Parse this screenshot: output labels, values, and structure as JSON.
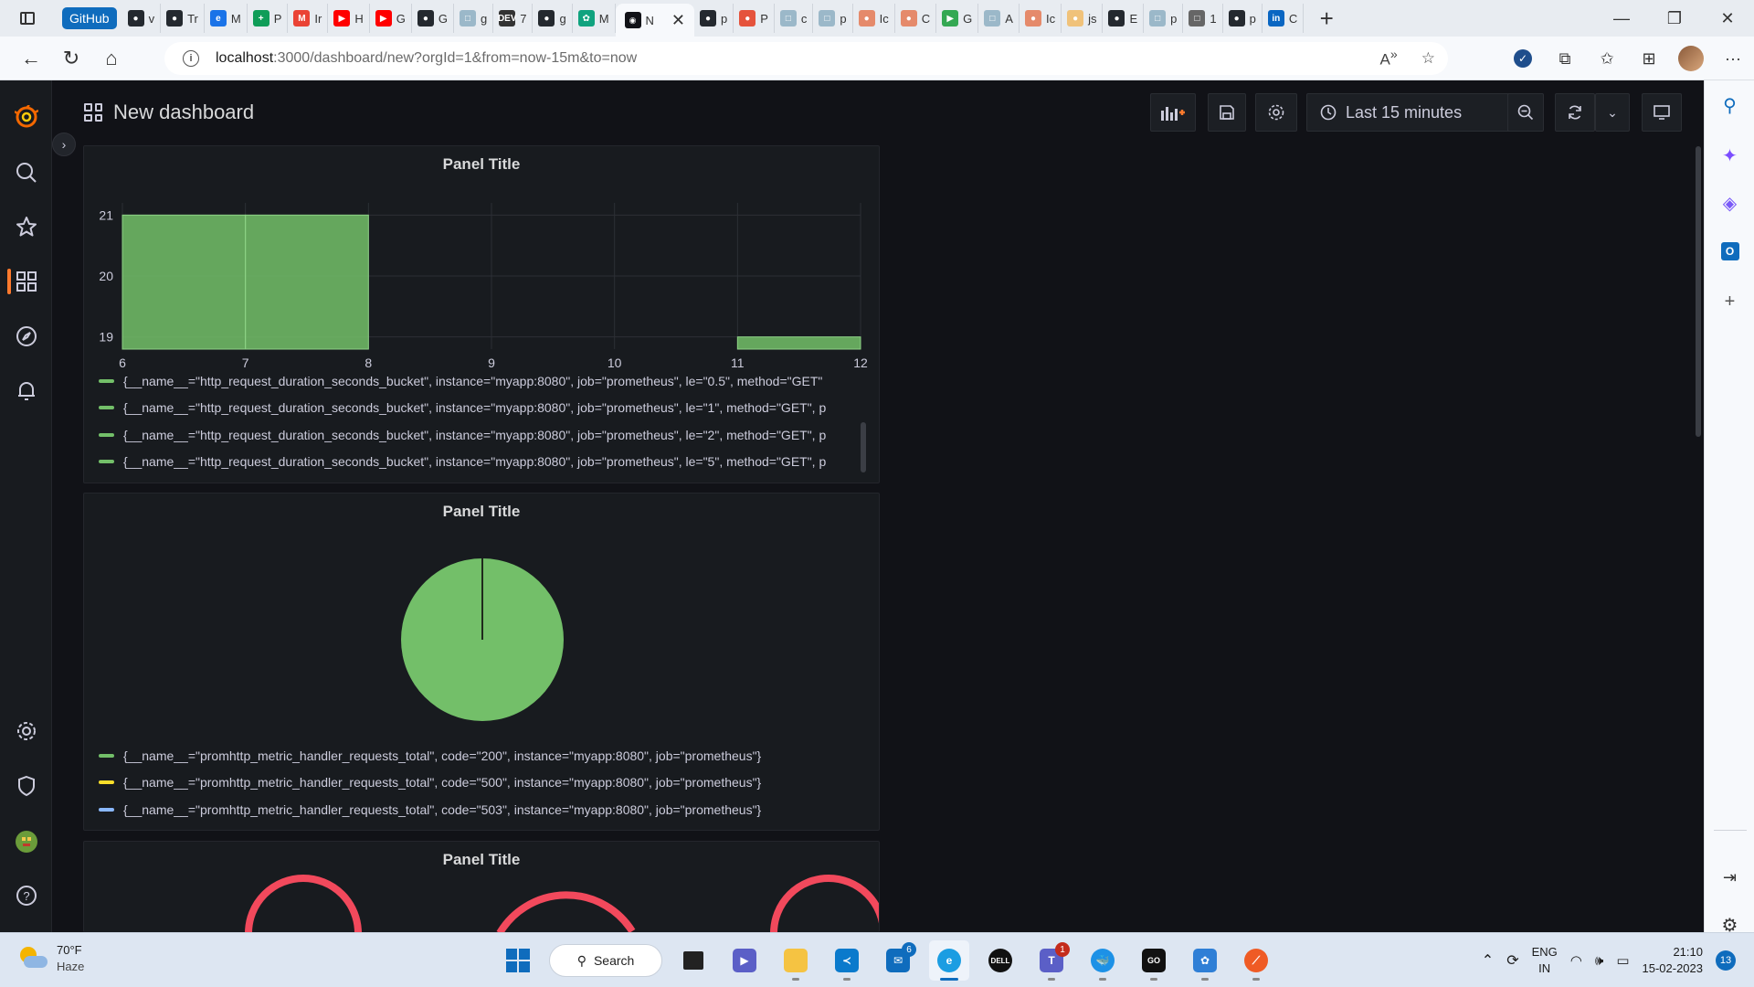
{
  "browser": {
    "tab_group_label": "GitHub",
    "tabs": [
      {
        "label": "v",
        "color": "#24292f",
        "glyph": "●"
      },
      {
        "label": "Tr",
        "color": "#24292f",
        "glyph": "●"
      },
      {
        "label": "M",
        "color": "#1a73e8",
        "glyph": "e"
      },
      {
        "label": "P",
        "color": "#0f9d58",
        "glyph": "+"
      },
      {
        "label": "Ir",
        "color": "#ea4335",
        "glyph": "M"
      },
      {
        "label": "H",
        "color": "#ff0000",
        "glyph": "▶"
      },
      {
        "label": "G",
        "color": "#ff0000",
        "glyph": "▶"
      },
      {
        "label": "G",
        "color": "#24292f",
        "glyph": "●"
      },
      {
        "label": "g",
        "color": "#9bb8c9",
        "glyph": "□"
      },
      {
        "label": "7",
        "color": "#333333",
        "glyph": "DEV"
      },
      {
        "label": "g",
        "color": "#24292f",
        "glyph": "●"
      },
      {
        "label": "M",
        "color": "#10a37f",
        "glyph": "✿"
      }
    ],
    "active_tab_label": "N",
    "tabs_after": [
      {
        "label": "p",
        "color": "#24292f",
        "glyph": "●"
      },
      {
        "label": "P",
        "color": "#e5533c",
        "glyph": "●"
      },
      {
        "label": "c",
        "color": "#9bb8c9",
        "glyph": "□"
      },
      {
        "label": "p",
        "color": "#9bb8c9",
        "glyph": "□"
      },
      {
        "label": "Ic",
        "color": "#e58a6b",
        "glyph": "●"
      },
      {
        "label": "C",
        "color": "#e58a6b",
        "glyph": "●"
      },
      {
        "label": "G",
        "color": "#34a853",
        "glyph": "▶"
      },
      {
        "label": "A",
        "color": "#9bb8c9",
        "glyph": "□"
      },
      {
        "label": "Ic",
        "color": "#e58a6b",
        "glyph": "●"
      },
      {
        "label": "js",
        "color": "#f0c27a",
        "glyph": "●"
      },
      {
        "label": "E",
        "color": "#24292f",
        "glyph": "●"
      },
      {
        "label": "p",
        "color": "#9bb8c9",
        "glyph": "□"
      },
      {
        "label": "1",
        "color": "#666666",
        "glyph": "□"
      },
      {
        "label": "p",
        "color": "#24292f",
        "glyph": "●"
      },
      {
        "label": "C",
        "color": "#0a66c2",
        "glyph": "in"
      }
    ],
    "url_host": "localhost",
    "url_rest": ":3000/dashboard/new?orgId=1&from=now-15m&to=now"
  },
  "dashboard": {
    "title": "New dashboard",
    "time_range": "Last 15 minutes"
  },
  "panels": [
    {
      "title": "Panel Title",
      "chart_data": {
        "type": "bar",
        "title": "Panel Title",
        "xlim": [
          6,
          12
        ],
        "ylim": [
          18.8,
          21.2
        ],
        "x_ticks": [
          "6",
          "7",
          "8",
          "9",
          "10",
          "11",
          "12"
        ],
        "y_ticks": [
          "19",
          "20",
          "21"
        ],
        "grid": true,
        "legend_placement": "bottom",
        "color": "#73bf69",
        "bars": [
          {
            "x0": 6,
            "x1": 7,
            "value": 21
          },
          {
            "x0": 7,
            "x1": 8,
            "value": 21
          },
          {
            "x0": 11,
            "x1": 12,
            "value": 19
          }
        ],
        "series": [
          {
            "name": "{__name__=\"http_request_duration_seconds_bucket\", instance=\"myapp:8080\", job=\"prometheus\", le=\"0.5\", method=\"GET\"",
            "color": "#73bf69"
          },
          {
            "name": "{__name__=\"http_request_duration_seconds_bucket\", instance=\"myapp:8080\", job=\"prometheus\", le=\"1\", method=\"GET\", p",
            "color": "#73bf69"
          },
          {
            "name": "{__name__=\"http_request_duration_seconds_bucket\", instance=\"myapp:8080\", job=\"prometheus\", le=\"2\", method=\"GET\", p",
            "color": "#73bf69"
          },
          {
            "name": "{__name__=\"http_request_duration_seconds_bucket\", instance=\"myapp:8080\", job=\"prometheus\", le=\"5\", method=\"GET\", p",
            "color": "#73bf69"
          }
        ]
      }
    },
    {
      "title": "Panel Title",
      "chart_data": {
        "type": "pie",
        "title": "Panel Title",
        "legend_placement": "bottom",
        "series": [
          {
            "name": "{__name__=\"promhttp_metric_handler_requests_total\", code=\"200\", instance=\"myapp:8080\", job=\"prometheus\"}",
            "value": 100,
            "color": "#73bf69"
          },
          {
            "name": "{__name__=\"promhttp_metric_handler_requests_total\", code=\"500\", instance=\"myapp:8080\", job=\"prometheus\"}",
            "value": 0,
            "color": "#fade2a"
          },
          {
            "name": "{__name__=\"promhttp_metric_handler_requests_total\", code=\"503\", instance=\"myapp:8080\", job=\"prometheus\"}",
            "value": 0,
            "color": "#8ab8ff"
          }
        ]
      }
    },
    {
      "title": "Panel Title"
    }
  ],
  "taskbar": {
    "weather_temp": "70°F",
    "weather_condition": "Haze",
    "search_label": "Search",
    "mail_badge": "6",
    "teams_badge": "1",
    "lang_line1": "ENG",
    "lang_line2": "IN",
    "time": "21:10",
    "date": "15-02-2023",
    "notification_count": "13"
  }
}
